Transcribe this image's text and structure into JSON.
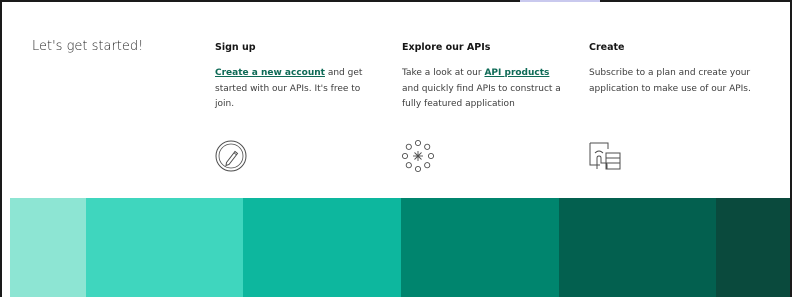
{
  "intro": {
    "text": "Let's get started!"
  },
  "columns": [
    {
      "title": "Sign up",
      "link": "Create a new account",
      "text_after": " and get started with our APIs. It's free to join.",
      "icon": "pencil-circle-icon"
    },
    {
      "title": "Explore our APIs",
      "text_before": "Take a look at our ",
      "link": "API products",
      "text_after": " and quickly find APIs to construct a fully featured application",
      "icon": "starburst-icon"
    },
    {
      "title": "Create",
      "text": "Subscribe to a plan and create your application to make use of our APIs.",
      "icon": "touch-screen-icon"
    }
  ],
  "colors": {
    "link": "#0e6a56",
    "stripes": [
      "#8de5d3",
      "#3fd6be",
      "#0db79e",
      "#00856e",
      "#03604f",
      "#0a4a3d"
    ]
  }
}
